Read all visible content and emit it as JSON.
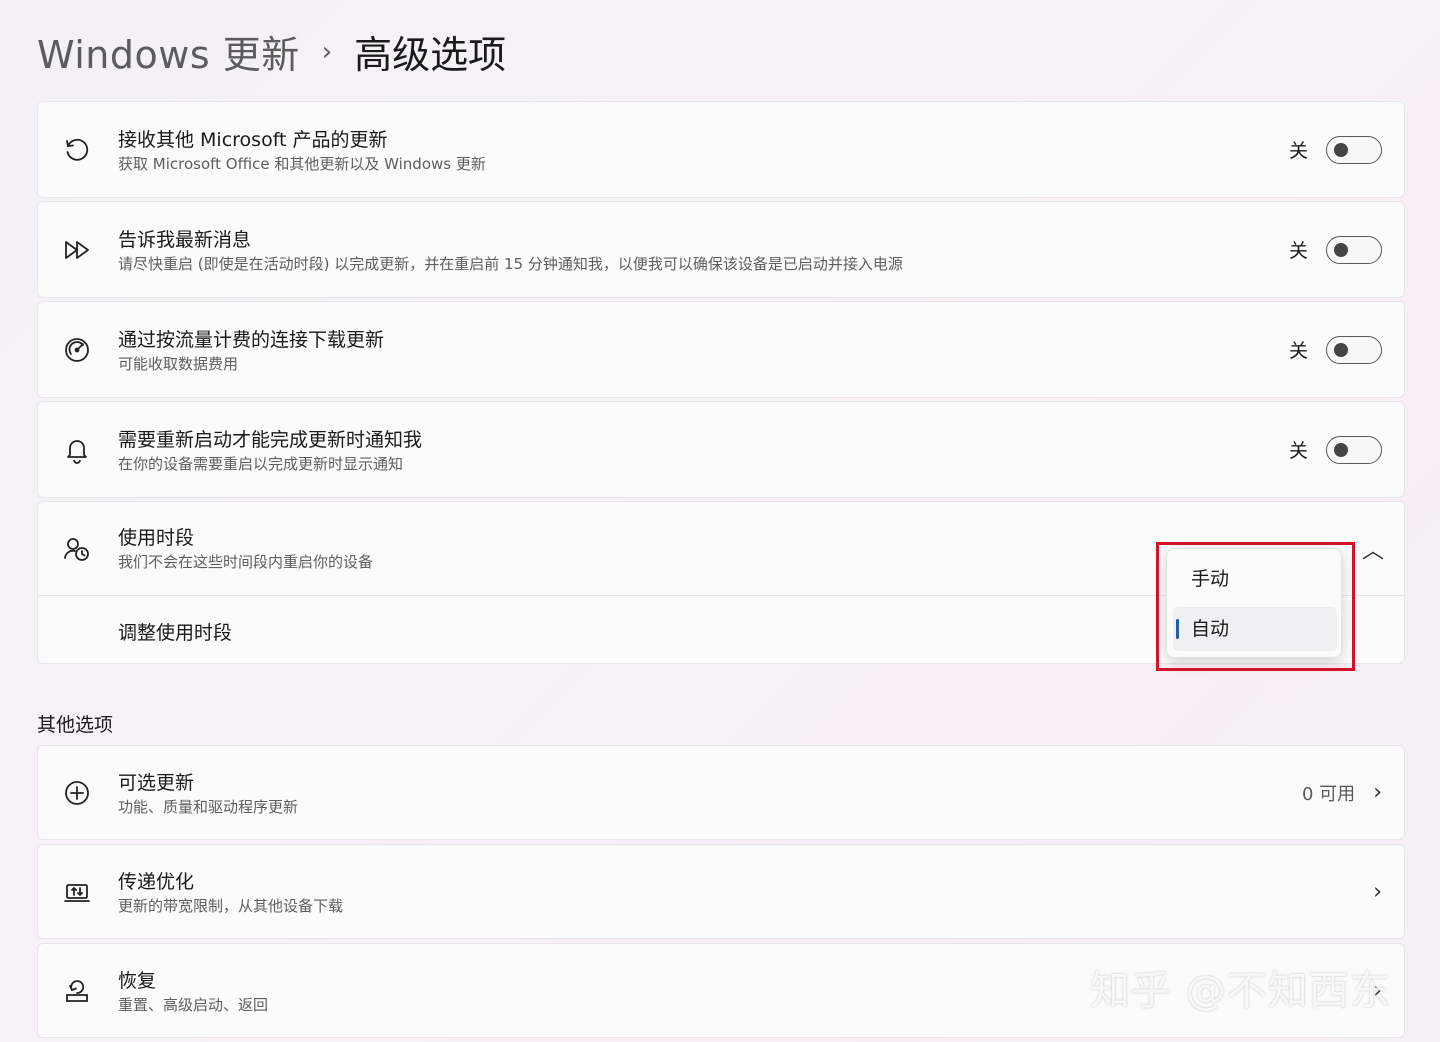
{
  "header": {
    "parent": "Windows 更新",
    "separator": "›",
    "current": "高级选项"
  },
  "settings": [
    {
      "icon": "history-icon",
      "title": "接收其他 Microsoft 产品的更新",
      "subtitle": "获取 Microsoft Office 和其他更新以及 Windows 更新",
      "state_label": "关",
      "on": false
    },
    {
      "icon": "fast-forward-icon",
      "title": "告诉我最新消息",
      "subtitle": "请尽快重启 (即使是在活动时段) 以完成更新，并在重启前 15 分钟通知我，以便我可以确保该设备是已启动并接入电源",
      "state_label": "关",
      "on": false
    },
    {
      "icon": "speedometer-icon",
      "title": "通过按流量计费的连接下载更新",
      "subtitle": "可能收取数据费用",
      "state_label": "关",
      "on": false
    },
    {
      "icon": "bell-icon",
      "title": "需要重新启动才能完成更新时通知我",
      "subtitle": "在你的设备需要重启以完成更新时显示通知",
      "state_label": "关",
      "on": false
    }
  ],
  "active_hours": {
    "icon": "clock-user-icon",
    "title": "使用时段",
    "subtitle": "我们不会在这些时间段内重启你的设备",
    "adjust_label": "调整使用时段",
    "collapse_icon": "chevron-up-icon",
    "dropdown": {
      "options": [
        "手动",
        "自动"
      ],
      "selected": "自动"
    }
  },
  "other_options": {
    "label": "其他选项",
    "items": [
      {
        "icon": "plus-circle-icon",
        "title": "可选更新",
        "subtitle": "功能、质量和驱动程序更新",
        "value": "0 可用"
      },
      {
        "icon": "delivery-optimization-icon",
        "title": "传递优化",
        "subtitle": "更新的带宽限制，从其他设备下载",
        "value": ""
      },
      {
        "icon": "recovery-icon",
        "title": "恢复",
        "subtitle": "重置、高级启动、返回",
        "value": ""
      }
    ]
  },
  "watermark": "知乎 @不知西东",
  "colors": {
    "accent": "#1f5fa8",
    "highlight": "#d2142a"
  }
}
